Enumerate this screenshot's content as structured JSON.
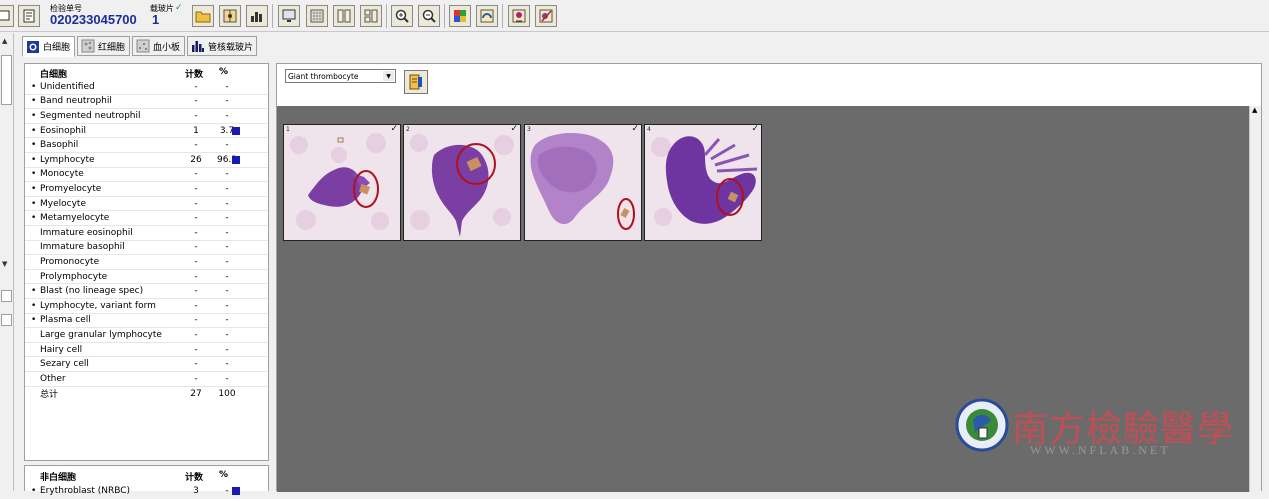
{
  "header": {
    "specimen_label": "检验单号",
    "specimen_number": "020233045700",
    "slide_label": "载玻片",
    "slide_check": "✓",
    "slide_number": "1"
  },
  "tabs": [
    {
      "label": "白细胞",
      "active": true
    },
    {
      "label": "红细胞",
      "active": false
    },
    {
      "label": "血小板",
      "active": false
    },
    {
      "label": "管核载玻片",
      "active": false
    }
  ],
  "wbc_table": {
    "header_name": "白细胞",
    "header_count": "计数",
    "header_percent": "%",
    "rows": [
      {
        "bullet": "•",
        "name": "Unidentified",
        "count": "-",
        "percent": "-"
      },
      {
        "bullet": "•",
        "name": "Band neutrophil",
        "count": "-",
        "percent": "-"
      },
      {
        "bullet": "•",
        "name": "Segmented neutrophil",
        "count": "-",
        "percent": "-"
      },
      {
        "bullet": "•",
        "name": "Eosinophil",
        "count": "1",
        "percent": "3.7",
        "marked": true
      },
      {
        "bullet": "•",
        "name": "Basophil",
        "count": "-",
        "percent": "-"
      },
      {
        "bullet": "•",
        "name": "Lymphocyte",
        "count": "26",
        "percent": "96.3",
        "marked": true
      },
      {
        "bullet": "•",
        "name": "Monocyte",
        "count": "-",
        "percent": "-"
      },
      {
        "bullet": "•",
        "name": "Promyelocyte",
        "count": "-",
        "percent": "-"
      },
      {
        "bullet": "•",
        "name": "Myelocyte",
        "count": "-",
        "percent": "-"
      },
      {
        "bullet": "•",
        "name": "Metamyelocyte",
        "count": "-",
        "percent": "-"
      },
      {
        "bullet": "",
        "name": "Immature eosinophil",
        "count": "-",
        "percent": "-"
      },
      {
        "bullet": "",
        "name": "Immature basophil",
        "count": "-",
        "percent": "-"
      },
      {
        "bullet": "",
        "name": "Promonocyte",
        "count": "-",
        "percent": "-"
      },
      {
        "bullet": "",
        "name": "Prolymphocyte",
        "count": "-",
        "percent": "-"
      },
      {
        "bullet": "•",
        "name": "Blast (no lineage spec)",
        "count": "-",
        "percent": "-"
      },
      {
        "bullet": "•",
        "name": "Lymphocyte, variant form",
        "count": "-",
        "percent": "-"
      },
      {
        "bullet": "•",
        "name": "Plasma cell",
        "count": "-",
        "percent": "-"
      },
      {
        "bullet": "",
        "name": "Large granular lymphocyte",
        "count": "-",
        "percent": "-"
      },
      {
        "bullet": "",
        "name": "Hairy cell",
        "count": "-",
        "percent": "-"
      },
      {
        "bullet": "",
        "name": "Sezary cell",
        "count": "-",
        "percent": "-"
      },
      {
        "bullet": "",
        "name": "Other",
        "count": "-",
        "percent": "-"
      },
      {
        "bullet": "",
        "name": "总计",
        "count": "27",
        "percent": "100"
      }
    ]
  },
  "non_wbc_table": {
    "header_name": "非白细胞",
    "header_count": "计数",
    "header_percent": "%",
    "rows": [
      {
        "bullet": "•",
        "name": "Erythroblast (NRBC)",
        "count": "3",
        "percent": "-",
        "marked": true
      }
    ]
  },
  "cell_class_select": {
    "value": "Giant thrombocyte"
  },
  "gallery": {
    "thumbnails": [
      {
        "number": "1",
        "check": "✓"
      },
      {
        "number": "2",
        "check": "✓"
      },
      {
        "number": "3",
        "check": "✓"
      },
      {
        "number": "4",
        "check": "✓"
      }
    ]
  },
  "watermark": {
    "text": "南方檢驗醫學",
    "url": "WWW.NFLAB.NET"
  },
  "colors": {
    "accent_blue": "#1a2f9e",
    "marker": "#1a1ab0",
    "gallery_bg": "#6b6b6b",
    "watermark_red": "#d24a52"
  }
}
